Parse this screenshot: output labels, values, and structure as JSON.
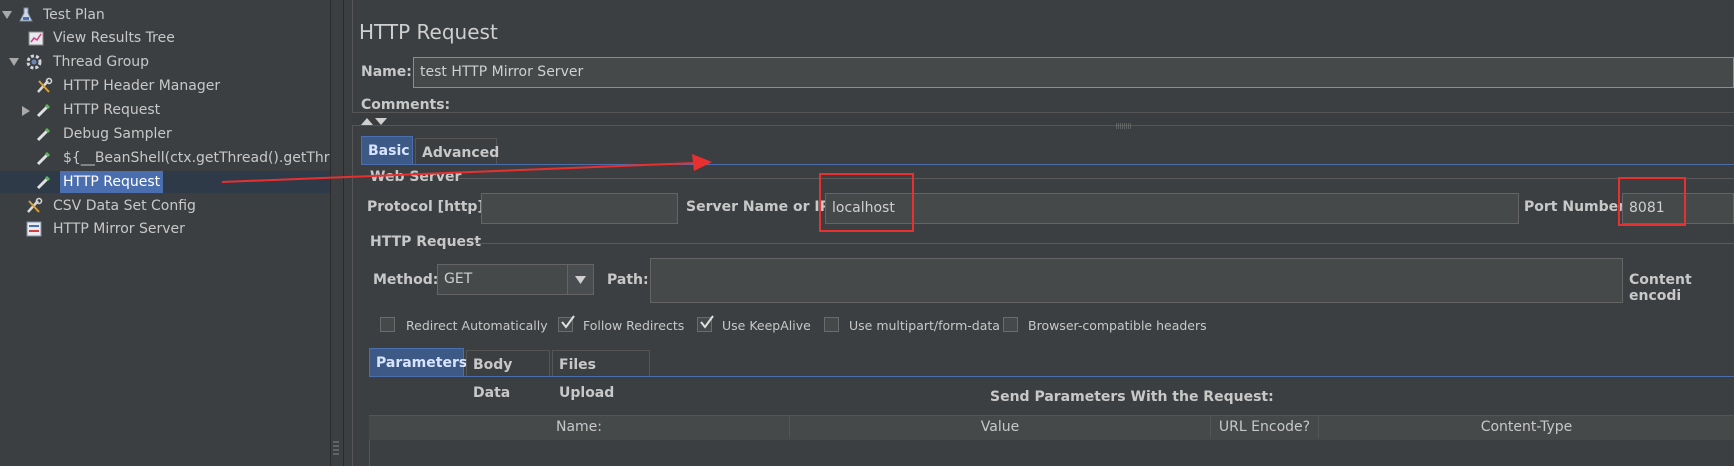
{
  "tree": {
    "items": [
      {
        "label": "Test Plan",
        "icon": "flask-icon"
      },
      {
        "label": "View Results Tree",
        "icon": "chart-icon"
      },
      {
        "label": "Thread Group",
        "icon": "gear-icon"
      },
      {
        "label": "HTTP Header Manager",
        "icon": "wrench-icon"
      },
      {
        "label": "HTTP Request",
        "icon": "pipette-icon"
      },
      {
        "label": "Debug Sampler",
        "icon": "pipette-icon"
      },
      {
        "label": "${__BeanShell(ctx.getThread().getThre",
        "icon": "pipette-icon"
      },
      {
        "label": "HTTP Request",
        "icon": "pipette-icon",
        "selected": true
      },
      {
        "label": "CSV Data Set Config",
        "icon": "wrench-icon"
      },
      {
        "label": "HTTP Mirror Server",
        "icon": "server-icon"
      }
    ]
  },
  "panel": {
    "title": "HTTP Request",
    "name_label": "Name:",
    "name_value": "test HTTP Mirror Server",
    "comments_label": "Comments:",
    "tabs": [
      "Basic",
      "Advanced"
    ],
    "web_server": {
      "title": "Web Server",
      "protocol_label": "Protocol [http]:",
      "protocol_value": "",
      "server_label": "Server Name or IP:",
      "server_value": "localhost",
      "port_label": "Port Number:",
      "port_value": "8081"
    },
    "http_request": {
      "title": "HTTP Request",
      "method_label": "Method:",
      "method_value": "GET",
      "path_label": "Path:",
      "path_value": "",
      "content_encoding_label": "Content encodi"
    },
    "checkboxes": [
      {
        "label": "Redirect Automatically",
        "checked": false
      },
      {
        "label": "Follow Redirects",
        "checked": true
      },
      {
        "label": "Use KeepAlive",
        "checked": true
      },
      {
        "label": "Use multipart/form-data",
        "checked": false
      },
      {
        "label": "Browser-compatible headers",
        "checked": false
      }
    ],
    "sub_tabs": [
      "Parameters",
      "Body Data",
      "Files Upload"
    ],
    "params_title": "Send Parameters With the Request:",
    "columns": [
      "Name:",
      "Value",
      "URL Encode?",
      "Content-Type"
    ]
  },
  "colors": {
    "selection": "#4b6eaf",
    "annotation": "#e83030",
    "background": "#3c3f41"
  }
}
